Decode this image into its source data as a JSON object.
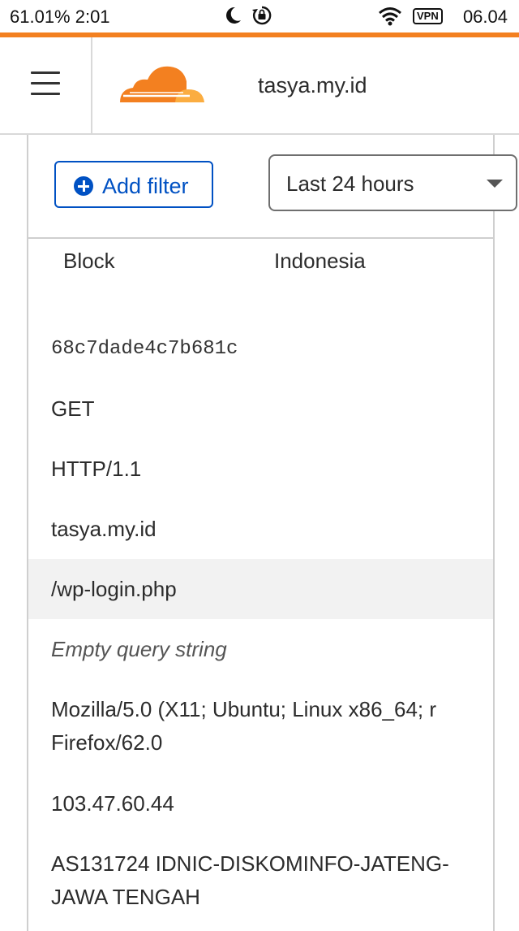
{
  "status_bar": {
    "left_text": "61.01% 2:01",
    "vpn_label": "VPN",
    "right_text": "06.04",
    "icons": [
      "moon-icon",
      "rotation-lock-icon",
      "wifi-icon"
    ]
  },
  "header": {
    "site_name": "tasya.my.id",
    "logo": "cloudflare-logo",
    "accent_color": "#f38020"
  },
  "toolbar": {
    "add_filter_label": "Add filter",
    "time_range": "Last 24 hours",
    "accent_color": "#0051c3"
  },
  "event": {
    "action": "Block",
    "country": "Indonesia",
    "ray_id": "68c7dade4c7b681c",
    "method": "GET",
    "protocol": "HTTP/1.1",
    "host": "tasya.my.id",
    "path": "/wp-login.php",
    "query": "Empty query string",
    "user_agent_line1": "Mozilla/5.0 (X11; Ubuntu; Linux x86_64; r",
    "user_agent_line2": "Firefox/62.0",
    "ip": "103.47.60.44",
    "asn_line1": "AS131724 IDNIC-DISKOMINFO-JATENG-",
    "asn_line2": "JAWA TENGAH"
  }
}
